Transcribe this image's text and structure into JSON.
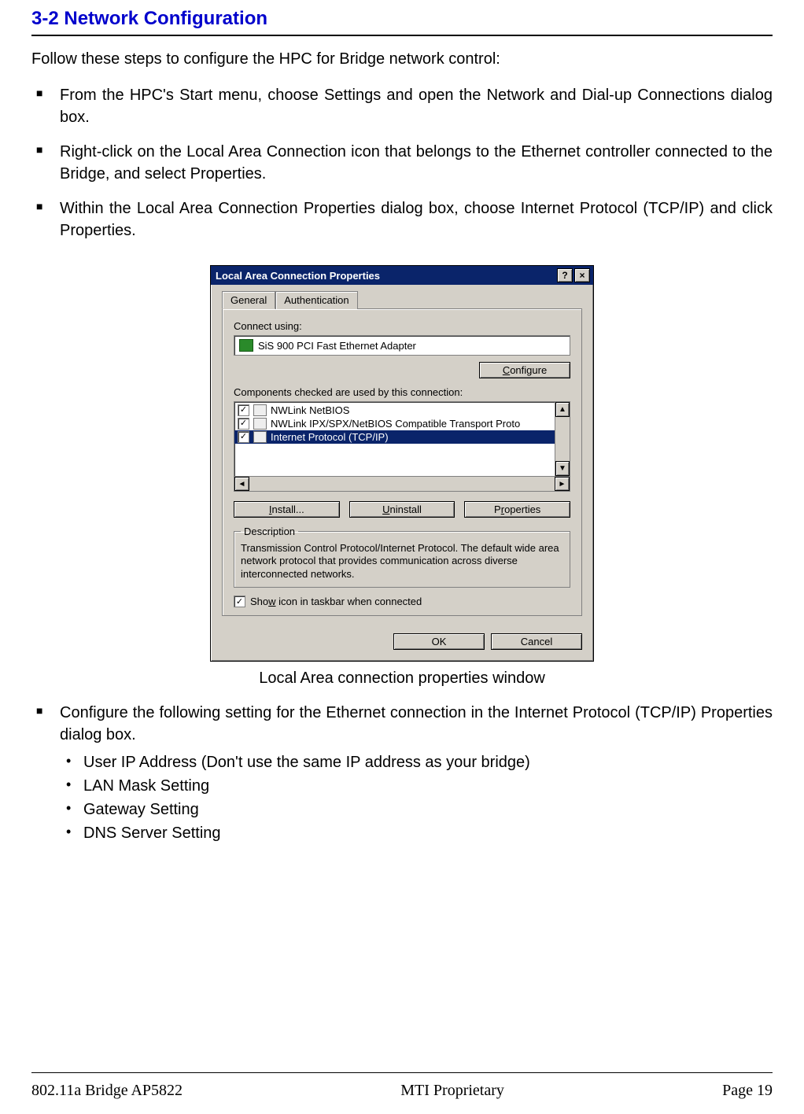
{
  "section_title": "3-2 Network Configuration",
  "intro": "Follow these steps to configure the HPC for Bridge network control:",
  "bullets_top": [
    "From the HPC's Start menu, choose Settings and open the Network and Dial-up Connections dialog box.",
    "Right-click on the Local Area Connection icon that belongs to the Ethernet controller connected to the Bridge, and select Properties.",
    "Within the Local Area Connection Properties dialog box, choose Internet Protocol (TCP/IP) and click Properties."
  ],
  "dialog": {
    "title": "Local Area Connection Properties",
    "help_btn": "?",
    "close_btn": "×",
    "tabs": {
      "general": "General",
      "auth": "Authentication"
    },
    "connect_using_label": "Connect using:",
    "adapter": "SiS 900 PCI Fast Ethernet Adapter",
    "configure_btn": "Configure",
    "components_label": "Components checked are used by this connection:",
    "components": [
      {
        "label": "NWLink NetBIOS",
        "checked": true,
        "selected": false
      },
      {
        "label": "NWLink IPX/SPX/NetBIOS Compatible Transport Proto",
        "checked": true,
        "selected": false
      },
      {
        "label": "Internet Protocol (TCP/IP)",
        "checked": true,
        "selected": true
      }
    ],
    "install_btn": "Install...",
    "uninstall_btn": "Uninstall",
    "properties_btn": "Properties",
    "description_legend": "Description",
    "description_text": "Transmission Control Protocol/Internet Protocol. The default wide area network protocol that provides communication across diverse interconnected networks.",
    "show_icon_label": "Show icon in taskbar when connected",
    "ok_btn": "OK",
    "cancel_btn": "Cancel"
  },
  "figure_caption": "Local Area connection properties window",
  "bullet_config": "Configure the following setting for the Ethernet connection in the Internet Protocol (TCP/IP) Properties dialog box.",
  "sub_bullets": [
    "User IP Address (Don't use the same IP address as your bridge)",
    "LAN Mask Setting",
    "Gateway Setting",
    "DNS Server Setting"
  ],
  "footer": {
    "left": "802.11a Bridge AP5822",
    "center": "MTI Proprietary",
    "right": "Page 19"
  }
}
